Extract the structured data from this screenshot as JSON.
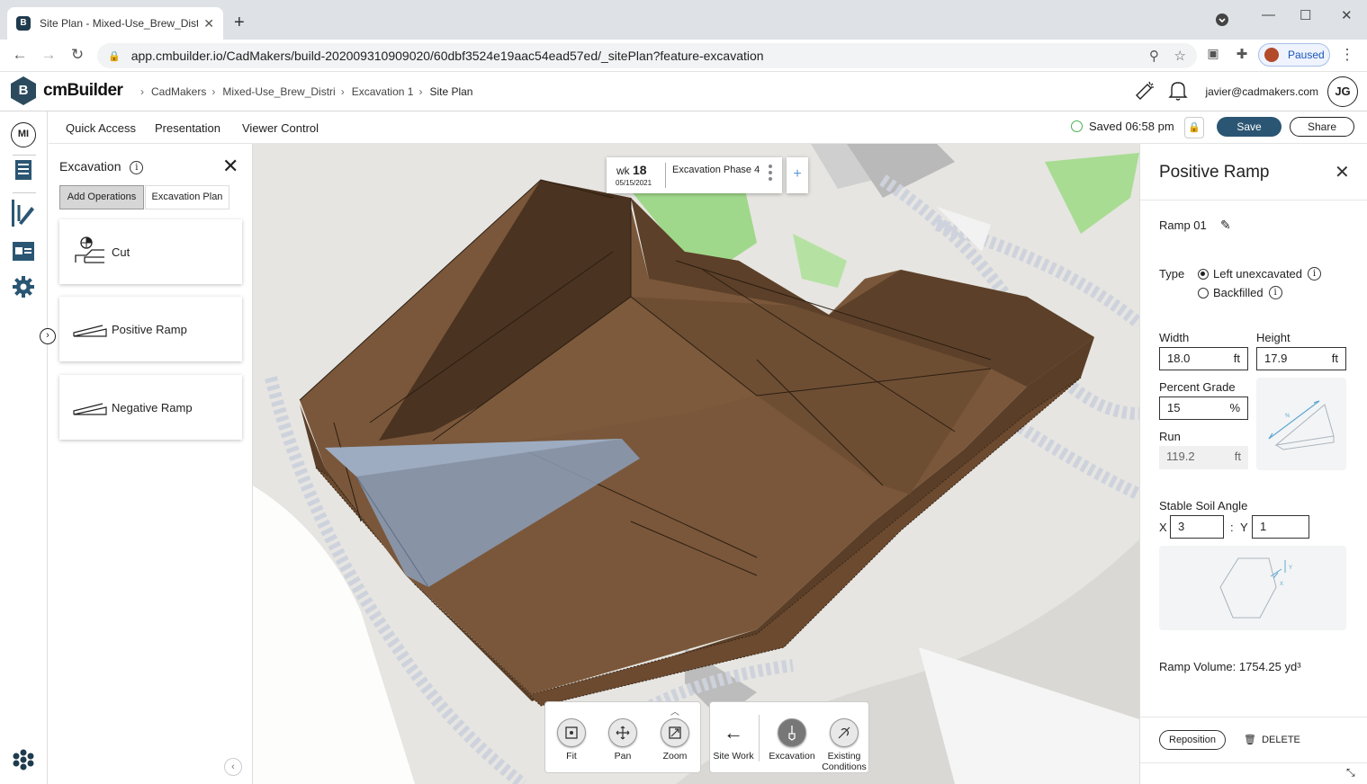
{
  "browser": {
    "tab_title": "Site Plan - Mixed-Use_Brew_Distr",
    "url": "app.cmbuilder.io/CadMakers/build-202009310909020/60dbf3524e19aac54ead57ed/_sitePlan?feature-excavation",
    "profile_status": "Paused"
  },
  "app": {
    "name": "cmBuilder",
    "logo_letter": "B",
    "breadcrumbs": [
      "CadMakers",
      "Mixed-Use_Brew_Distri",
      "Excavation 1",
      "Site Plan"
    ],
    "user_email": "javier@cadmakers.com",
    "user_initials": "JG",
    "rail_initials": "MI"
  },
  "menu": {
    "items": [
      "Quick Access",
      "Presentation",
      "Viewer Control"
    ],
    "saved_status": "Saved 06:58 pm",
    "save_label": "Save",
    "share_label": "Share"
  },
  "excavation_panel": {
    "title": "Excavation",
    "tabs": [
      "Add Operations",
      "Excavation Plan"
    ],
    "operations": [
      "Cut",
      "Positive Ramp",
      "Negative Ramp"
    ]
  },
  "phase": {
    "wk_label": "wk",
    "week": "18",
    "date": "05/15/2021",
    "name": "Excavation Phase 4",
    "add_symbol": "+"
  },
  "toolbar": {
    "nav_tools": [
      "Fit",
      "Pan",
      "Zoom"
    ],
    "back_label": "Site Work",
    "modes": [
      "Excavation",
      "Existing Conditions"
    ]
  },
  "ramp_panel": {
    "title": "Positive Ramp",
    "ramp_name": "Ramp 01",
    "type_label": "Type",
    "type_options": [
      "Left unexcavated",
      "Backfilled"
    ],
    "selected_type": "Left unexcavated",
    "width_label": "Width",
    "width_value": "18.0",
    "width_unit": "ft",
    "height_label": "Height",
    "height_value": "17.9",
    "height_unit": "ft",
    "grade_label": "Percent Grade",
    "grade_value": "15",
    "grade_unit": "%",
    "run_label": "Run",
    "run_value": "119.2",
    "run_unit": "ft",
    "soil_label": "Stable Soil Angle",
    "soil_x_label": "X",
    "soil_x_value": "3",
    "soil_sep": ":",
    "soil_y_label": "Y",
    "soil_y_value": "1",
    "volume": "Ramp Volume: 1754.25 yd³",
    "reposition_label": "Reposition",
    "delete_label": "DELETE"
  },
  "colors": {
    "brand_dark": "#2b5673",
    "terrain_brown": "#7a573a",
    "ramp_blue": "#8b9db8",
    "grass_green": "#9fd88a"
  }
}
